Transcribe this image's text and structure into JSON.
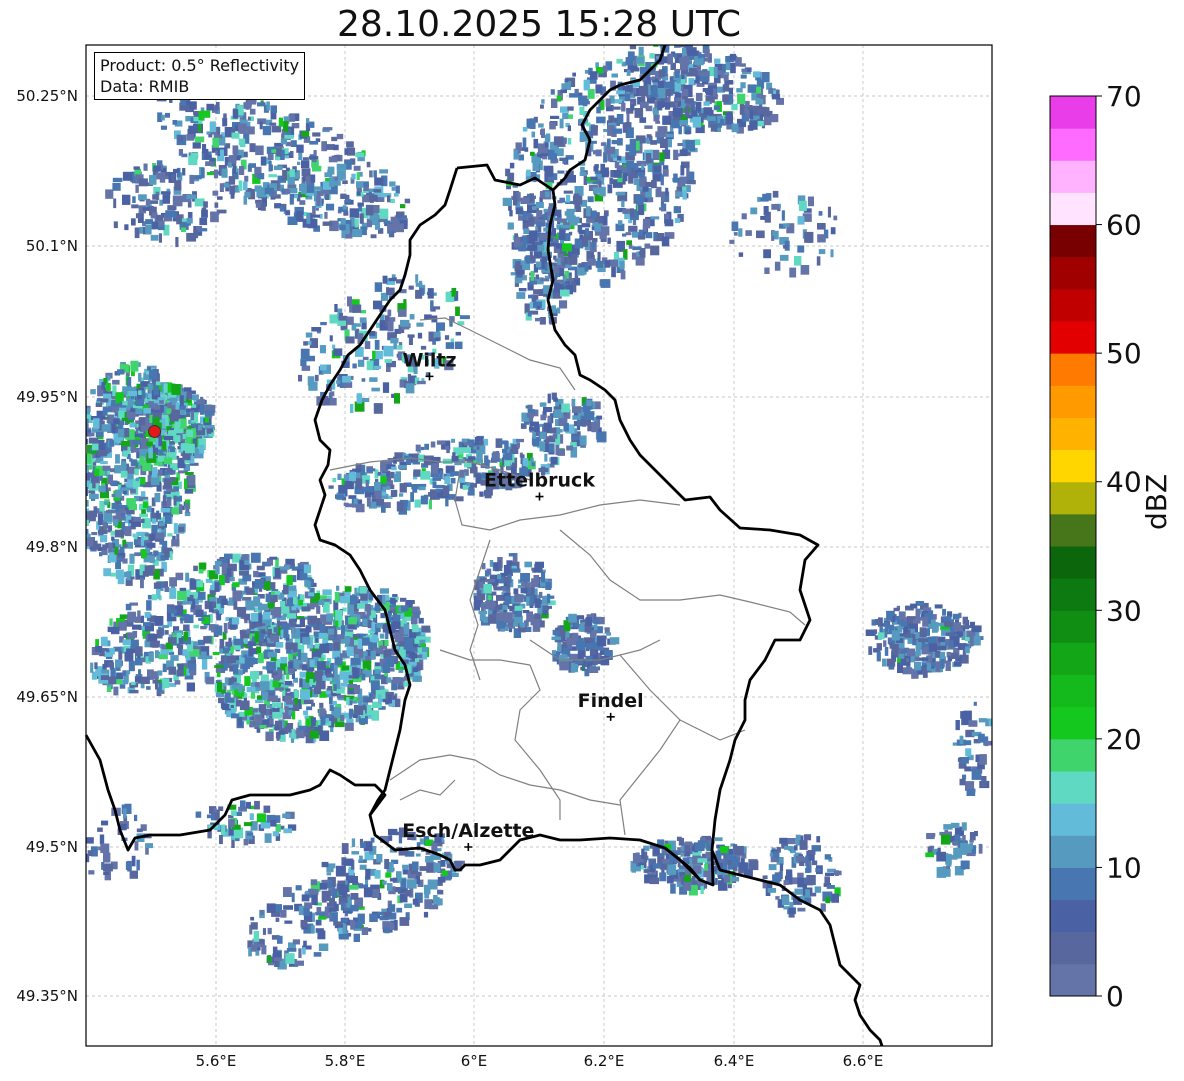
{
  "title": "28.10.2025 15:28 UTC",
  "info": {
    "product": "Product: 0.5° Reflectivity",
    "data_source": "Data: RMIB"
  },
  "axes": {
    "lon_ticks": [
      "5.6°E",
      "5.8°E",
      "6°E",
      "6.2°E",
      "6.4°E",
      "6.6°E"
    ],
    "lat_ticks": [
      "50.25°N",
      "50.1°N",
      "49.95°N",
      "49.8°N",
      "49.65°N",
      "49.5°N",
      "49.35°N"
    ]
  },
  "cities": [
    {
      "name": "Wiltz",
      "lon": 5.93,
      "lat": 49.97
    },
    {
      "name": "Ettelbruck",
      "lon": 6.1,
      "lat": 49.85
    },
    {
      "name": "Findel",
      "lon": 6.21,
      "lat": 49.63
    },
    {
      "name": "Esch/Alzette",
      "lon": 5.99,
      "lat": 49.5
    }
  ],
  "radar_site": {
    "lon": 5.505,
    "lat": 49.915,
    "color": "#e11919"
  },
  "colorbar": {
    "label": "dBZ",
    "min": 0,
    "max": 70,
    "step": 2.5,
    "tick_labels": [
      "0",
      "10",
      "20",
      "30",
      "40",
      "50",
      "60",
      "70"
    ],
    "colors": [
      "#6474a8",
      "#58689e",
      "#4a62a4",
      "#4876b0",
      "#579abf",
      "#62bbd8",
      "#5fd9c1",
      "#3fd46c",
      "#14c81e",
      "#14b91b",
      "#13a616",
      "#108e14",
      "#0c7a10",
      "#0b660c",
      "#47761a",
      "#b0b20a",
      "#ffd600",
      "#ffb300",
      "#ff9a00",
      "#ff7a00",
      "#e30000",
      "#c00000",
      "#a00000",
      "#780000",
      "#ffe3ff",
      "#ffb3ff",
      "#ff6bff",
      "#e83de8"
    ]
  }
}
